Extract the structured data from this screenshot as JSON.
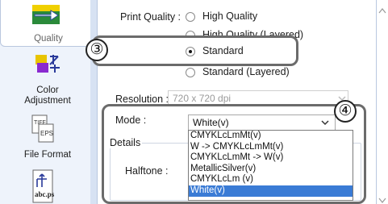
{
  "sidebar": {
    "items": [
      {
        "label": "Quality",
        "icon": "quality-arrows-icon"
      },
      {
        "label": "Color Adjustment",
        "line1": "Color",
        "line2": "Adjustment",
        "icon": "color-adjustment-icon"
      },
      {
        "label": "File Format",
        "icon": "file-format-icon",
        "icon_text": "TIFF EPS"
      },
      {
        "label": "",
        "icon": "layout-text-icon",
        "icon_text": "abc.ps"
      }
    ]
  },
  "print_quality": {
    "label": "Print Quality :",
    "options": [
      {
        "label": "High Quality",
        "checked": false
      },
      {
        "label": "High Quality (Layered)",
        "checked": false
      },
      {
        "label": "Standard",
        "checked": true
      },
      {
        "label": "Standard (Layered)",
        "checked": false
      }
    ]
  },
  "resolution": {
    "label": "Resolution :",
    "value": "720 x 720 dpi"
  },
  "mode": {
    "label": "Mode :",
    "value": "White(v)",
    "options": [
      "CMYKLcLmMt(v)",
      "W -> CMYKLcLmMt(v)",
      "CMYKLcLmMt -> W(v)",
      "MetallicSilver(v)",
      "CMYKLcLm (v)",
      "White(v)"
    ],
    "selected_index": 5
  },
  "details": {
    "label": "Details"
  },
  "halftone": {
    "label": "Halftone :"
  },
  "callouts": [
    "③",
    "④"
  ],
  "colors": {
    "sidebar_bg": "#eef3fb",
    "selection": "#3a7bd5",
    "callout_border": "#6b6b6b"
  }
}
